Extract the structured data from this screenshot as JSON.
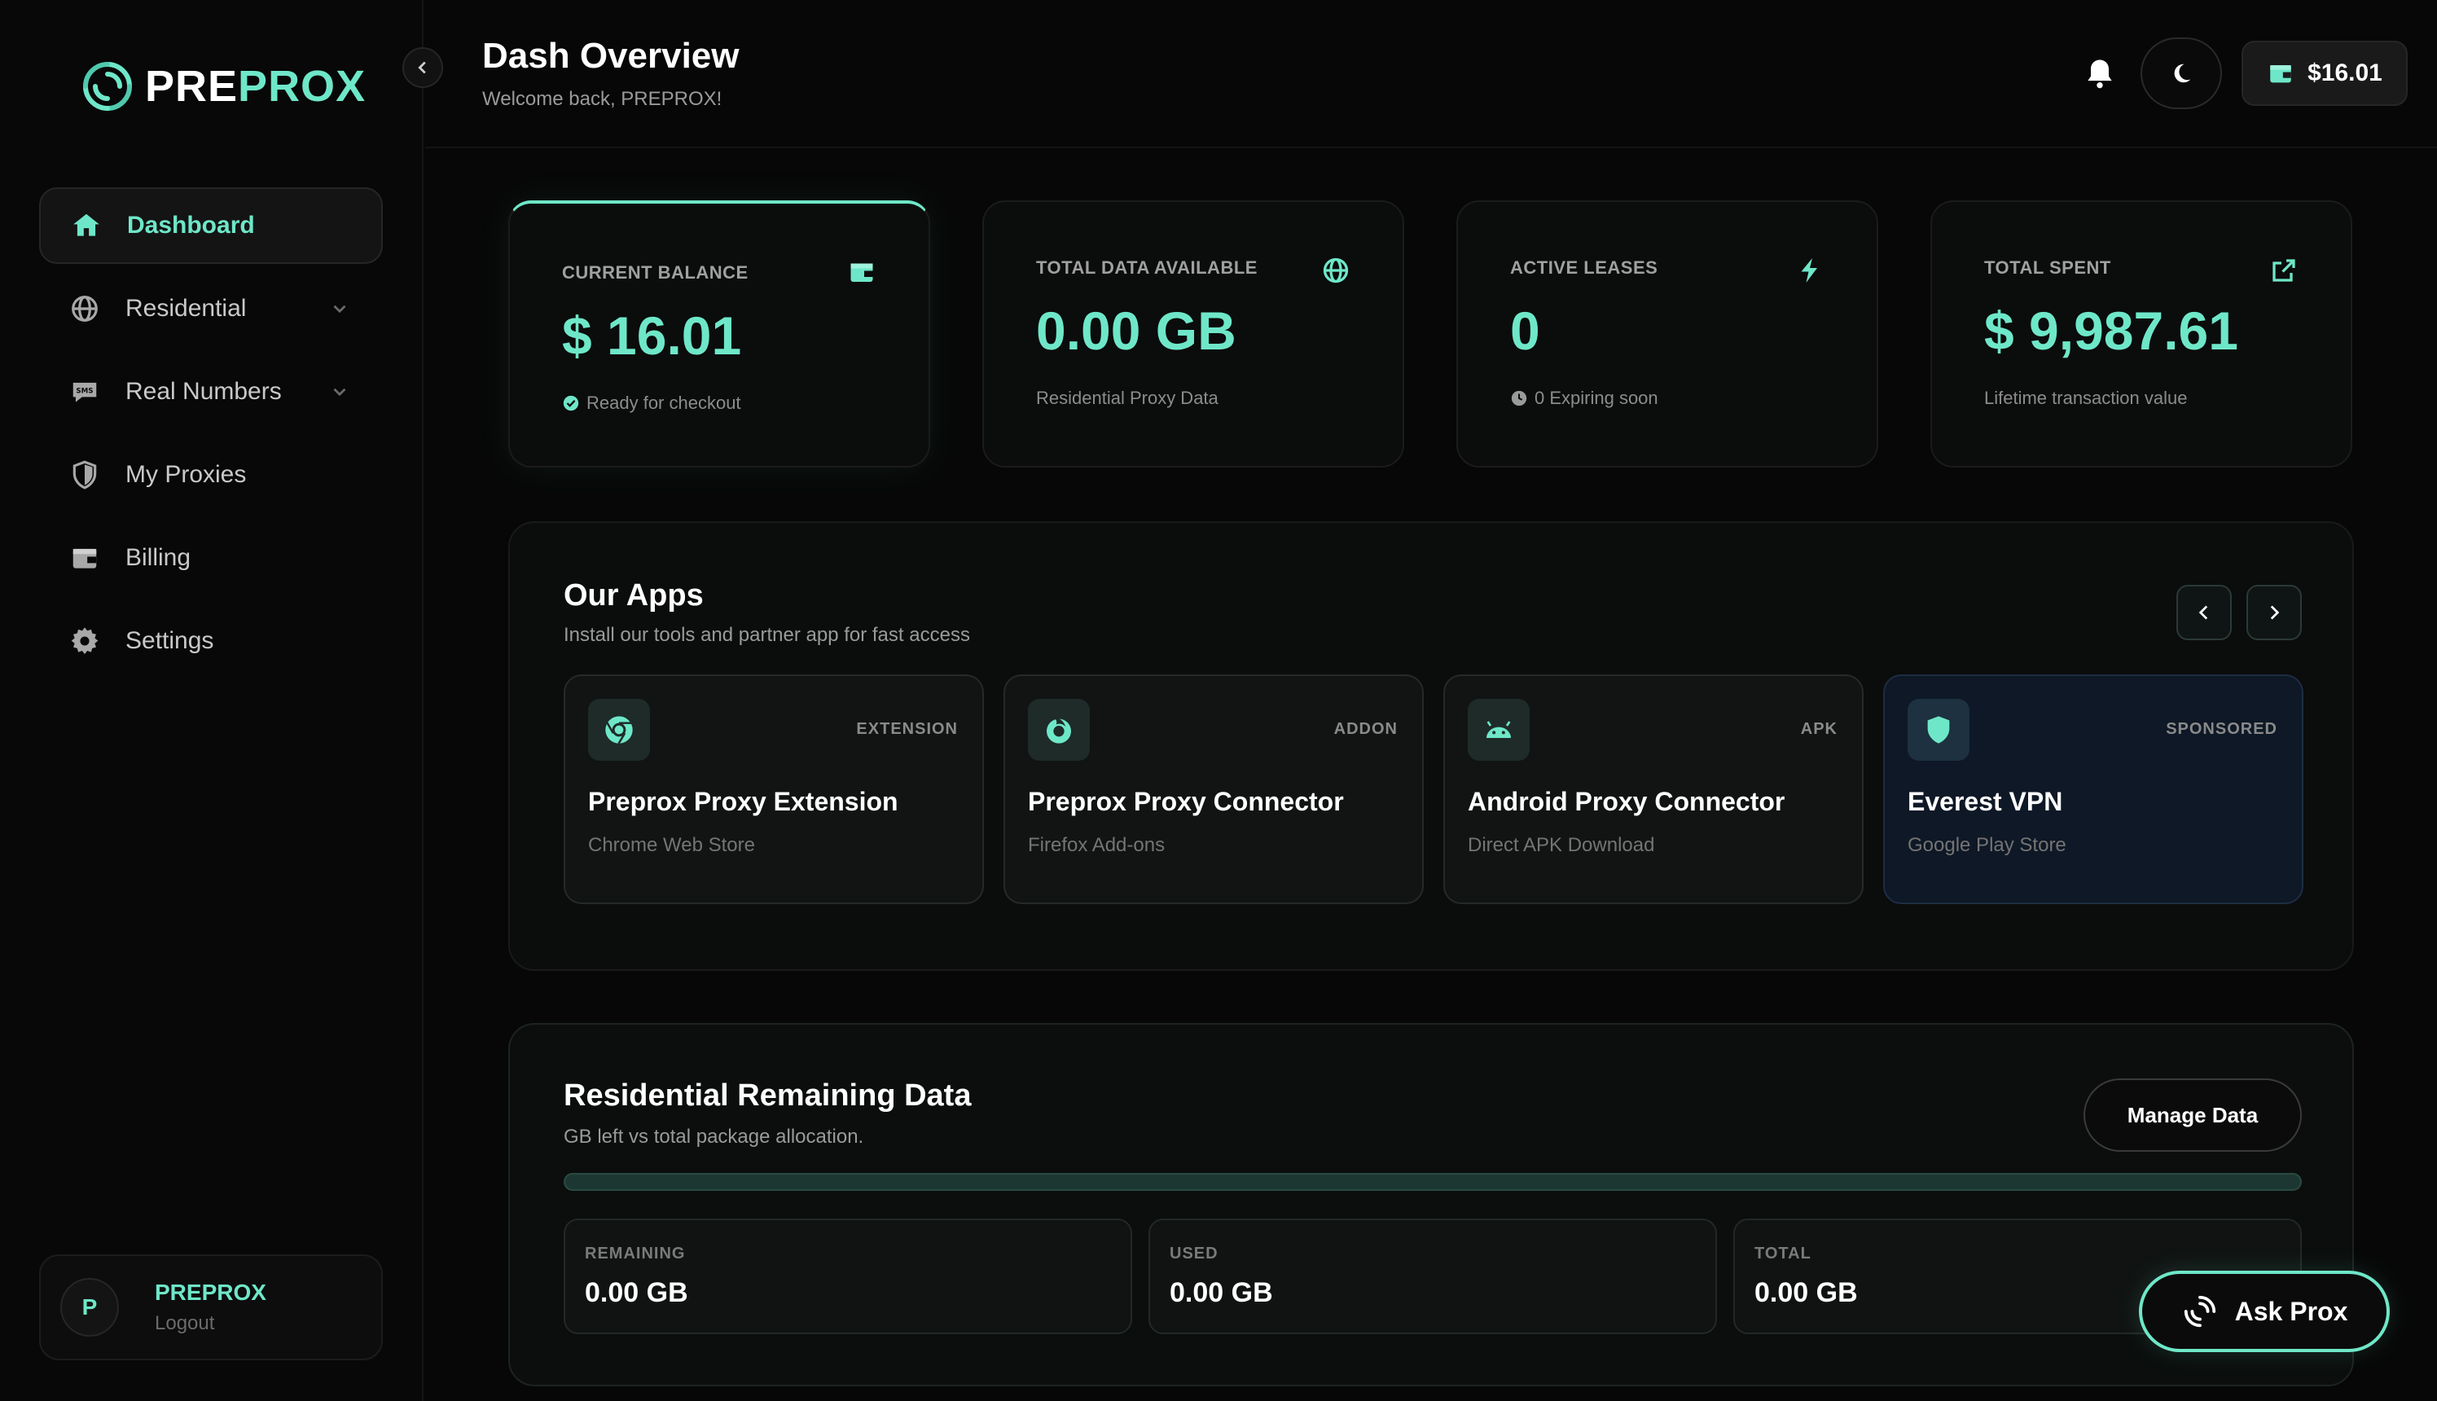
{
  "brand": {
    "name_part1": "PRE",
    "name_part2": "PROX",
    "accent_color": "#6ee7c8"
  },
  "sidebar": {
    "items": [
      {
        "label": "Dashboard",
        "icon": "home-icon",
        "active": true
      },
      {
        "label": "Residential",
        "icon": "globe-icon",
        "expandable": true
      },
      {
        "label": "Real Numbers",
        "icon": "sms-icon",
        "expandable": true
      },
      {
        "label": "My Proxies",
        "icon": "shield-icon"
      },
      {
        "label": "Billing",
        "icon": "wallet-icon"
      },
      {
        "label": "Settings",
        "icon": "gear-icon"
      }
    ],
    "user": {
      "initial": "P",
      "name": "PREPROX",
      "logout": "Logout"
    }
  },
  "header": {
    "title": "Dash Overview",
    "subtitle": "Welcome back, PREPROX!",
    "balance": "$16.01"
  },
  "stats": [
    {
      "label": "CURRENT BALANCE",
      "value": "$ 16.01",
      "note": "Ready for checkout",
      "icon": "wallet-icon"
    },
    {
      "label": "TOTAL DATA AVAILABLE",
      "value": "0.00 GB",
      "note": "Residential Proxy Data",
      "icon": "globe-icon"
    },
    {
      "label": "ACTIVE LEASES",
      "value": "0",
      "note": "0 Expiring soon",
      "icon": "bolt-icon"
    },
    {
      "label": "TOTAL SPENT",
      "value": "$ 9,987.61",
      "note": "Lifetime transaction value",
      "icon": "external-link-icon"
    }
  ],
  "apps": {
    "title": "Our Apps",
    "subtitle": "Install our tools and partner app for fast access",
    "items": [
      {
        "tag": "EXTENSION",
        "name": "Preprox Proxy Extension",
        "source": "Chrome Web Store",
        "icon": "chrome-icon"
      },
      {
        "tag": "ADDON",
        "name": "Preprox Proxy Connector",
        "source": "Firefox Add-ons",
        "icon": "firefox-icon"
      },
      {
        "tag": "APK",
        "name": "Android Proxy Connector",
        "source": "Direct APK Download",
        "icon": "android-icon"
      },
      {
        "tag": "SPONSORED",
        "name": "Everest VPN",
        "source": "Google Play Store",
        "icon": "shield-icon"
      }
    ]
  },
  "residential": {
    "title": "Residential Remaining Data",
    "subtitle": "GB left vs total package allocation.",
    "manage_label": "Manage Data",
    "progress_fraction": 0,
    "boxes": [
      {
        "label": "REMAINING",
        "value": "0.00 GB"
      },
      {
        "label": "USED",
        "value": "0.00 GB"
      },
      {
        "label": "TOTAL",
        "value": "0.00 GB"
      }
    ]
  },
  "assistant": {
    "label": "Ask Prox"
  }
}
